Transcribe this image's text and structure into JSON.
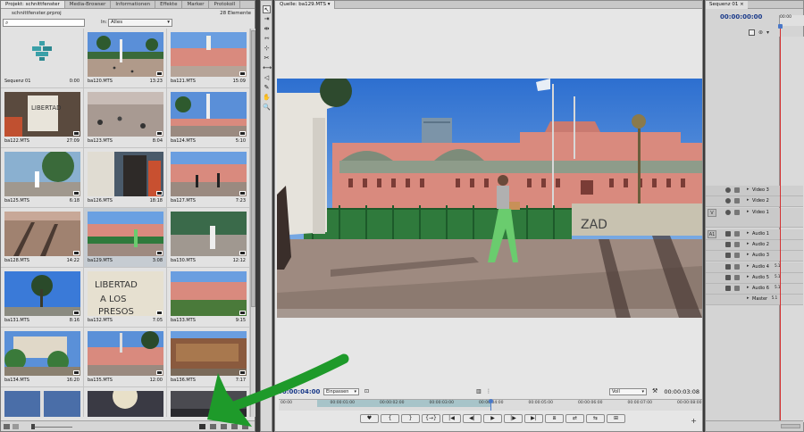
{
  "project_panel": {
    "tabs": [
      "Projekt: schnittfenster",
      "Media-Browser",
      "Informationen",
      "Effekte",
      "Marker",
      "Protokoll"
    ],
    "active_tab": "Projekt: schnittfenster",
    "file_name": "schnittfenster.prproj",
    "item_count": "28 Elemente",
    "search_value": "",
    "in_label": "In:",
    "in_value": "Alles",
    "items": [
      {
        "name": "Sequenz 01",
        "duration": "0:00",
        "kind": "sequence"
      },
      {
        "name": "ba120.MTS",
        "duration": "13:23",
        "kind": "clip",
        "scene": "plaza-pigeons"
      },
      {
        "name": "ba121.MTS",
        "duration": "15:09",
        "kind": "clip",
        "scene": "pink-house"
      },
      {
        "name": "ba122.MTS",
        "duration": "27:09",
        "kind": "clip",
        "scene": "graffiti-wall"
      },
      {
        "name": "ba123.MTS",
        "duration": "8:04",
        "kind": "clip",
        "scene": "pigeons-ground"
      },
      {
        "name": "ba124.MTS",
        "duration": "5:10",
        "kind": "clip",
        "scene": "obelisk-palms"
      },
      {
        "name": "ba125.MTS",
        "duration": "6:18",
        "kind": "clip",
        "scene": "street-trees"
      },
      {
        "name": "ba126.MTS",
        "duration": "18:18",
        "kind": "clip",
        "scene": "walker-closeup"
      },
      {
        "name": "ba127.MTS",
        "duration": "7:23",
        "kind": "clip",
        "scene": "pink-house-people"
      },
      {
        "name": "ba128.MTS",
        "duration": "14:22",
        "kind": "clip",
        "scene": "shadows"
      },
      {
        "name": "ba129.MTS",
        "duration": "3:08",
        "kind": "clip",
        "scene": "pink-house-fence",
        "selected": true
      },
      {
        "name": "ba130.MTS",
        "duration": "12:12",
        "kind": "clip",
        "scene": "walker-fence"
      },
      {
        "name": "ba131.MTS",
        "duration": "8:16",
        "kind": "clip",
        "scene": "palm-sky"
      },
      {
        "name": "ba132.MTS",
        "duration": "7:05",
        "kind": "clip",
        "scene": "graffiti-libertad"
      },
      {
        "name": "ba133.MTS",
        "duration": "9:15",
        "kind": "clip",
        "scene": "pink-facade"
      },
      {
        "name": "ba134.MTS",
        "duration": "16:20",
        "kind": "clip",
        "scene": "palace-trees"
      },
      {
        "name": "ba135.MTS",
        "duration": "12:00",
        "kind": "clip",
        "scene": "pink-house-palm"
      },
      {
        "name": "ba136.MTS",
        "duration": "7:17",
        "kind": "clip",
        "scene": "banner-wall"
      },
      {
        "name": "",
        "duration": "",
        "kind": "clip",
        "scene": "obelisk-dusk"
      },
      {
        "name": "",
        "duration": "",
        "kind": "clip",
        "scene": "sun-glare"
      },
      {
        "name": "",
        "duration": "",
        "kind": "clip",
        "scene": "dark-street"
      }
    ]
  },
  "source_monitor": {
    "tab": "Quelle: ba129.MTS",
    "timecode_in": "00:00:04:00",
    "fit_value": "Einpassen",
    "quality_value": "Voll",
    "duration": "00:00:03:08",
    "ruler_labels": [
      "00:00",
      "00:00:01:00",
      "00:00:02:00",
      "00:00:03:00",
      "00:00:04:00",
      "00:00:05:00",
      "00:00:06:00",
      "00:00:07:00",
      "00:00:08:00"
    ],
    "playhead_fraction": 0.5,
    "in_fraction": 0.09,
    "out_fraction": 0.5,
    "transport": [
      {
        "label": "♥",
        "name": "marker-button"
      },
      {
        "label": "{",
        "name": "mark-in-button"
      },
      {
        "label": "}",
        "name": "mark-out-button"
      },
      {
        "label": "{→}",
        "name": "go-to-in-button"
      },
      {
        "label": "|◀",
        "name": "step-back-in-button"
      },
      {
        "label": "◀|",
        "name": "step-back-button"
      },
      {
        "label": "▶",
        "name": "play-button"
      },
      {
        "label": "|▶",
        "name": "step-forward-button"
      },
      {
        "label": "▶|",
        "name": "go-to-out-button"
      },
      {
        "label": "⧈",
        "name": "export-frame-button"
      },
      {
        "label": "⇄",
        "name": "insert-button"
      },
      {
        "label": "⇆",
        "name": "overwrite-button"
      },
      {
        "label": "⊞",
        "name": "settings-button"
      }
    ],
    "add_label": "+"
  },
  "tools": [
    "↖",
    "⇥",
    "⇹",
    "⇿",
    "⊹",
    "✂",
    "⟷",
    "◁",
    "✎",
    "✋",
    "🔍"
  ],
  "sequence_panel": {
    "tab": "Sequenz 01 ×",
    "timecode": "00:00:00:00",
    "ruler_label": "00:00",
    "tracks": [
      {
        "name": "Video 3",
        "type": "video",
        "target": ""
      },
      {
        "name": "Video 2",
        "type": "video",
        "target": ""
      },
      {
        "name": "Video 1",
        "type": "video",
        "target": "V",
        "tall": true
      },
      {
        "name": "Audio 1",
        "type": "audio",
        "target": "A1"
      },
      {
        "name": "Audio 2",
        "type": "audio",
        "target": ""
      },
      {
        "name": "Audio 3",
        "type": "audio",
        "target": ""
      },
      {
        "name": "Audio 4",
        "type": "audio",
        "target": "",
        "suffix": "5.1"
      },
      {
        "name": "Audio 5",
        "type": "audio",
        "target": "",
        "suffix": "5.1"
      },
      {
        "name": "Audio 6",
        "type": "audio",
        "target": "",
        "suffix": "5.1"
      },
      {
        "name": "Master",
        "type": "master",
        "target": "",
        "suffix": "5.1"
      }
    ]
  },
  "colors": {
    "accent_timecode": "#1a3a8a",
    "annotation_arrow": "#1e9a2a",
    "playhead": "#d23030",
    "inout_range": "#a7c4c9"
  }
}
